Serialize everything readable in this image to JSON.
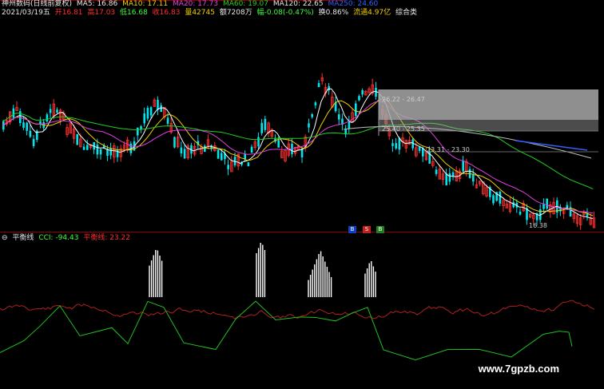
{
  "header": {
    "stock": "神州数码(日线前复权)",
    "ma5": "MA5: 16.86",
    "ma10": "MA10: 17.11",
    "ma20": "MA20: 17.73",
    "ma60": "MA60: 19.07",
    "ma120": "MA120: 22.65",
    "ma_extra": "MA250: 24.60"
  },
  "quote": {
    "date": "2021/03/19五",
    "open": "开16.81",
    "high": "高17.03",
    "low": "低16.68",
    "close": "收16.83",
    "volume": "量42745",
    "amount": "额7208万",
    "change": "幅-0.08(-0.47%)",
    "turnover": "换0.86%",
    "float": "流通4.97亿",
    "sector": "综合类"
  },
  "price_labels": {
    "zone1": "26.22 - 26.47",
    "zone2": "25.40 - 25.35",
    "zone3": "23.31 - 23.30",
    "low": "16.38"
  },
  "badges": {
    "a": "B",
    "b": "S",
    "c": "B"
  },
  "indicator": {
    "name": "平衡线",
    "cci": "CCI: -94.43",
    "balance": "平衡线: 23.22"
  },
  "watermark": "www.7gpzb.com",
  "colors": {
    "up": "#ff3030",
    "down": "#00ffff",
    "ma5": "#ffffff",
    "ma10": "#f0d000",
    "ma20": "#e040e0",
    "ma60": "#20d020",
    "ma120": "#3060ff",
    "cci": "#20c020",
    "balance": "#c02020"
  }
}
